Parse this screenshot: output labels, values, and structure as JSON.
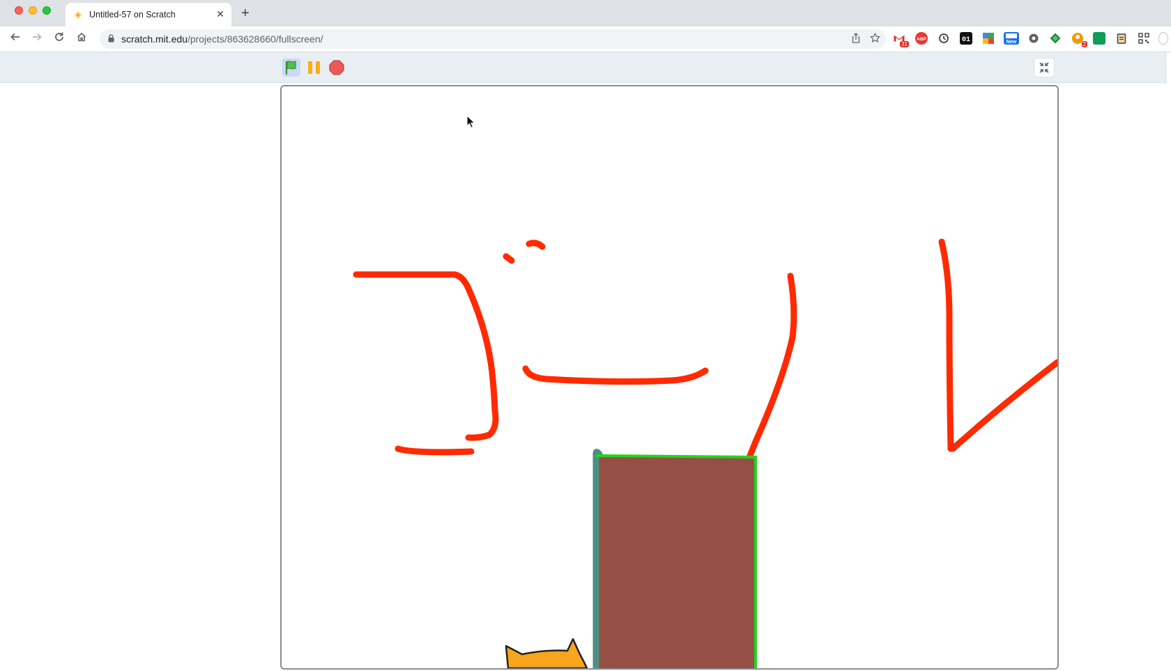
{
  "browser": {
    "tab": {
      "title": "Untitled-57 on Scratch",
      "favicon": "scratch-cat-icon",
      "close_glyph": "✕"
    },
    "new_tab_glyph": "+",
    "address": {
      "host": "scratch.mit.edu",
      "path": "/projects/863628660/fullscreen/"
    },
    "extensions": [
      {
        "name": "gmail-icon",
        "badge": "31"
      },
      {
        "name": "adblock-plus-icon",
        "badge": ""
      },
      {
        "name": "sync-icon",
        "badge": ""
      },
      {
        "name": "binary-01-icon",
        "badge": ""
      },
      {
        "name": "google-maps-icon",
        "badge": ""
      },
      {
        "name": "new-extension-icon",
        "badge": "New"
      },
      {
        "name": "gear-extension-icon",
        "badge": ""
      },
      {
        "name": "green-diamond-icon",
        "badge": ""
      },
      {
        "name": "orange-person-icon",
        "badge": "2"
      },
      {
        "name": "green-square-icon",
        "badge": ""
      },
      {
        "name": "clipboard-icon",
        "badge": ""
      },
      {
        "name": "qr-code-icon",
        "badge": ""
      }
    ]
  },
  "scratch": {
    "controls": {
      "green_flag": "green-flag-icon",
      "pause": "pause-icon",
      "stop": "stop-icon",
      "unfullscreen": "exit-fullscreen-icon"
    },
    "stage": {
      "sprites": [
        "scratch-cat",
        "brown-block"
      ],
      "drawing_text": "ゴール"
    }
  },
  "colors": {
    "pen_red": "#ff2a00",
    "block_brown": "#954f44",
    "block_left_edge": "#4b8f86",
    "block_top_right_edge": "#22d41e",
    "cat_orange": "#f9a51b"
  }
}
